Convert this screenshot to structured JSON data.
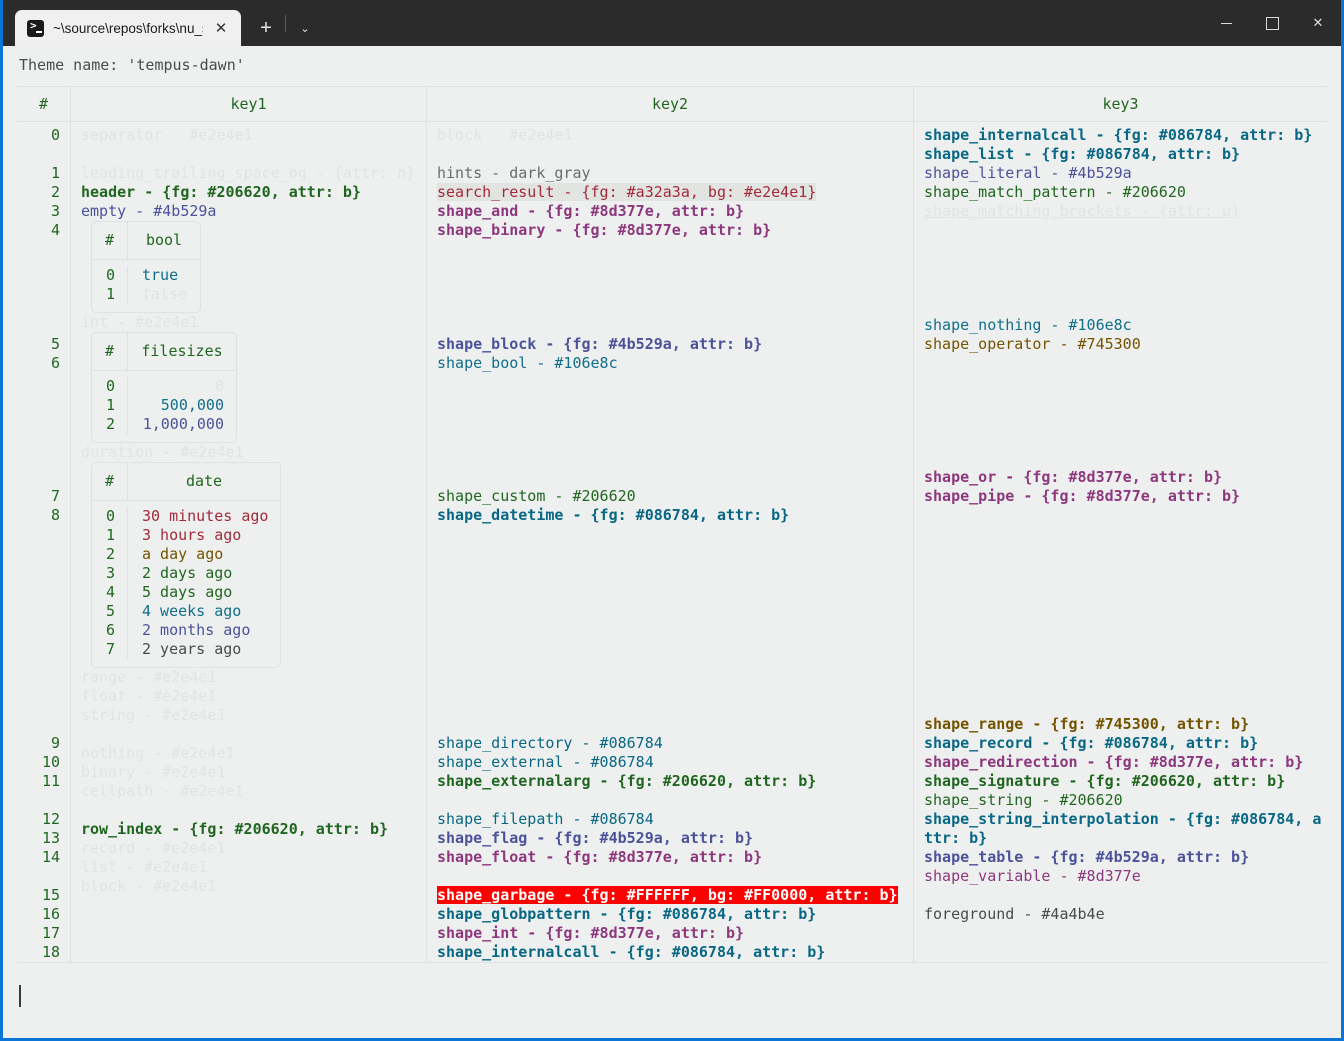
{
  "window": {
    "tab_title": "~\\source\\repos\\forks\\nu_scrip",
    "tab_icon": "powershell-icon",
    "close_label": "✕",
    "newtab_label": "+",
    "dropdown_label": "⌄",
    "minimize_label": "",
    "maximize_label": "",
    "close_window_label": "✕",
    "accent_color": "#0c74d4",
    "titlebar_color": "#2b2b2b"
  },
  "terminal": {
    "theme_line": "Theme name: 'tempus-dawn'",
    "background": "#eef0ef",
    "foreground": "#4a4b4e"
  },
  "table": {
    "headers": [
      "#",
      "key1",
      "key2",
      "key3"
    ],
    "indices": [
      "0",
      "1",
      "2",
      "3",
      "4",
      "5",
      "6",
      "7",
      "8",
      "9",
      "10",
      "11",
      "12",
      "13",
      "14",
      "15",
      "16",
      "17",
      "18"
    ],
    "key1": [
      {
        "text": "separator - #e2e4e1",
        "style": "cFaint"
      },
      {
        "text": "",
        "style": "blank"
      },
      {
        "text": "leading_trailing_space_bg - {attr: n}",
        "style": "cFaint"
      },
      {
        "text": "header - {fg: #206620, attr: b}",
        "style": "cGreenB"
      },
      {
        "text": "empty - #4b529a",
        "style": "cPurple"
      },
      {
        "text": "__TABLE_BOOL__",
        "style": "table"
      },
      {
        "text": "int - #e2e4e1",
        "style": "cFaint"
      },
      {
        "text": "__TABLE_FILESIZES__",
        "style": "table"
      },
      {
        "text": "duration - #e2e4e1",
        "style": "cFaint"
      },
      {
        "text": "__TABLE_DATE__",
        "style": "table"
      },
      {
        "text": "range - #e2e4e1",
        "style": "cFaint"
      },
      {
        "text": "float - #e2e4e1",
        "style": "cFaint"
      },
      {
        "text": "string - #e2e4e1",
        "style": "cFaint"
      },
      {
        "text": "",
        "style": "blank"
      },
      {
        "text": "nothing - #e2e4e1",
        "style": "cFaint"
      },
      {
        "text": "binary - #e2e4e1",
        "style": "cFaint"
      },
      {
        "text": "cellpath - #e2e4e1",
        "style": "cFaint"
      },
      {
        "text": "",
        "style": "blank"
      },
      {
        "text": "row_index - {fg: #206620, attr: b}",
        "style": "cGreenB"
      },
      {
        "text": "record - #e2e4e1",
        "style": "cFaint"
      },
      {
        "text": "list - #e2e4e1",
        "style": "cFaint"
      },
      {
        "text": "block - #e2e4e1",
        "style": "cFaint"
      }
    ],
    "key2": [
      {
        "text": "block - #e2e4e1",
        "style": "cFaint"
      },
      {
        "text": "",
        "style": "blank"
      },
      {
        "text": "hints - dark_gray",
        "style": "cDarkGray"
      },
      {
        "text": "search_result - {fg: #a32a3a, bg: #e2e4e1}",
        "style": "cSearch"
      },
      {
        "text": "shape_and - {fg: #8d377e, attr: b}",
        "style": "cMagentaB"
      },
      {
        "text": "shape_binary - {fg: #8d377e, attr: b}",
        "style": "cMagentaB"
      },
      {
        "text": "shape_block - {fg: #4b529a, attr: b}",
        "style": "cPurpleB"
      },
      {
        "text": "shape_bool - #106e8c",
        "style": "cCyan"
      },
      {
        "text": "shape_custom - #206620",
        "style": "cGreen"
      },
      {
        "text": "shape_datetime - {fg: #086784, attr: b}",
        "style": "cTealB"
      },
      {
        "text": "shape_directory - #086784",
        "style": "cTeal"
      },
      {
        "text": "shape_external - #086784",
        "style": "cTeal"
      },
      {
        "text": "shape_externalarg - {fg: #206620, attr: b}",
        "style": "cGreenB"
      },
      {
        "text": "shape_filepath - #086784",
        "style": "cTeal"
      },
      {
        "text": "shape_flag - {fg: #4b529a, attr: b}",
        "style": "cPurpleB"
      },
      {
        "text": "shape_float - {fg: #8d377e, attr: b}",
        "style": "cMagentaB"
      },
      {
        "text": "shape_garbage - {fg: #FFFFFF, bg: #FF0000, attr: b}",
        "style": "cGarbage"
      },
      {
        "text": "shape_globpattern - {fg: #086784, attr: b}",
        "style": "cTealB"
      },
      {
        "text": "shape_int - {fg: #8d377e, attr: b}",
        "style": "cMagentaB"
      },
      {
        "text": "shape_internalcall - {fg: #086784, attr: b}",
        "style": "cTealB"
      }
    ],
    "key3": [
      {
        "text": "shape_internalcall - {fg: #086784, attr: b}",
        "style": "cTealB"
      },
      {
        "text": "shape_list - {fg: #086784, attr: b}",
        "style": "cTealB"
      },
      {
        "text": "shape_literal - #4b529a",
        "style": "cPurple"
      },
      {
        "text": "shape_match_pattern - #206620",
        "style": "cGreen"
      },
      {
        "text": "shape_matching_brackets - {attr: u}",
        "style": "cFaintU"
      },
      {
        "text": "shape_nothing - #106e8c",
        "style": "cCyan"
      },
      {
        "text": "shape_operator - #745300",
        "style": "cOlive"
      },
      {
        "text": "shape_or - {fg: #8d377e, attr: b}",
        "style": "cMagentaB"
      },
      {
        "text": "shape_pipe - {fg: #8d377e, attr: b}",
        "style": "cMagentaB"
      },
      {
        "text": "shape_range - {fg: #745300, attr: b}",
        "style": "cOliveB"
      },
      {
        "text": "shape_record - {fg: #086784, attr: b}",
        "style": "cTealB"
      },
      {
        "text": "shape_redirection - {fg: #8d377e, attr: b}",
        "style": "cMagentaB"
      },
      {
        "text": "shape_signature - {fg: #206620, attr: b}",
        "style": "cGreenB"
      },
      {
        "text": "shape_string - #206620",
        "style": "cGreen"
      },
      {
        "text": "shape_string_interpolation - {fg: #086784, attr: b}",
        "style": "cTealB"
      },
      {
        "text": "shape_table - {fg: #4b529a, attr: b}",
        "style": "cPurpleB"
      },
      {
        "text": "shape_variable - #8d377e",
        "style": "cMagenta"
      },
      {
        "text": "foreground - #4a4b4e",
        "style": "cGray"
      }
    ]
  },
  "nested_tables": {
    "bool": {
      "headers": [
        "#",
        "bool"
      ],
      "rows": [
        {
          "index": "0",
          "value": "true",
          "style": "cCyan"
        },
        {
          "index": "1",
          "value": "false",
          "style": "cFaint"
        }
      ]
    },
    "filesizes": {
      "headers": [
        "#",
        "filesizes"
      ],
      "rows": [
        {
          "index": "0",
          "value": "0",
          "style": "cFaint"
        },
        {
          "index": "1",
          "value": "500,000",
          "style": "cCyan"
        },
        {
          "index": "2",
          "value": "1,000,000",
          "style": "cPurple"
        }
      ]
    },
    "date": {
      "headers": [
        "#",
        "date"
      ],
      "rows": [
        {
          "index": "0",
          "value": "30 minutes ago",
          "style": "cCrimson"
        },
        {
          "index": "1",
          "value": "3 hours ago",
          "style": "cCrimson"
        },
        {
          "index": "2",
          "value": "a day ago",
          "style": "cOlive"
        },
        {
          "index": "3",
          "value": "2 days ago",
          "style": "cGreen"
        },
        {
          "index": "4",
          "value": "5 days ago",
          "style": "cGreen"
        },
        {
          "index": "5",
          "value": "4 weeks ago",
          "style": "cCyan"
        },
        {
          "index": "6",
          "value": "2 months ago",
          "style": "cPurple"
        },
        {
          "index": "7",
          "value": "2 years ago",
          "style": "cGray"
        }
      ]
    }
  }
}
